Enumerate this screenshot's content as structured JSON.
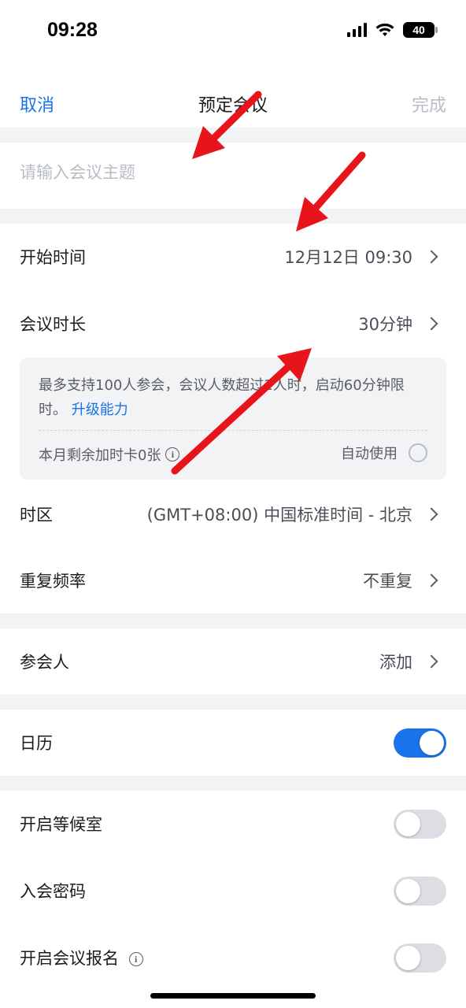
{
  "status_bar": {
    "time": "09:28",
    "battery": "40"
  },
  "nav": {
    "cancel": "取消",
    "title": "预定会议",
    "done": "完成"
  },
  "topic": {
    "placeholder": "请输入会议主题",
    "value": ""
  },
  "rows": {
    "start_time": {
      "label": "开始时间",
      "value": "12月12日 09:30"
    },
    "duration": {
      "label": "会议时长",
      "value": "30分钟"
    },
    "timezone": {
      "label": "时区",
      "value": "(GMT+08:00) 中国标准时间 - 北京"
    },
    "repeat": {
      "label": "重复频率",
      "value": "不重复"
    },
    "participants": {
      "label": "参会人",
      "value": "添加"
    },
    "calendar": {
      "label": "日历",
      "enabled": true
    },
    "waiting_room": {
      "label": "开启等候室",
      "enabled": false
    },
    "password": {
      "label": "入会密码",
      "enabled": false
    },
    "registration": {
      "label": "开启会议报名",
      "enabled": false
    }
  },
  "info_box": {
    "text": "最多支持100人参会，会议人数超过2人时，启动60分钟限时。",
    "link": "升级能力",
    "cards_left": "本月剩余加时卡0张",
    "auto_use": "自动使用"
  },
  "colors": {
    "accent": "#1a73e8",
    "annotation_arrow": "#e8141b"
  },
  "icons": [
    "chevron-right-icon",
    "info-icon",
    "radio-icon",
    "signal-icon",
    "wifi-icon",
    "battery-icon"
  ]
}
